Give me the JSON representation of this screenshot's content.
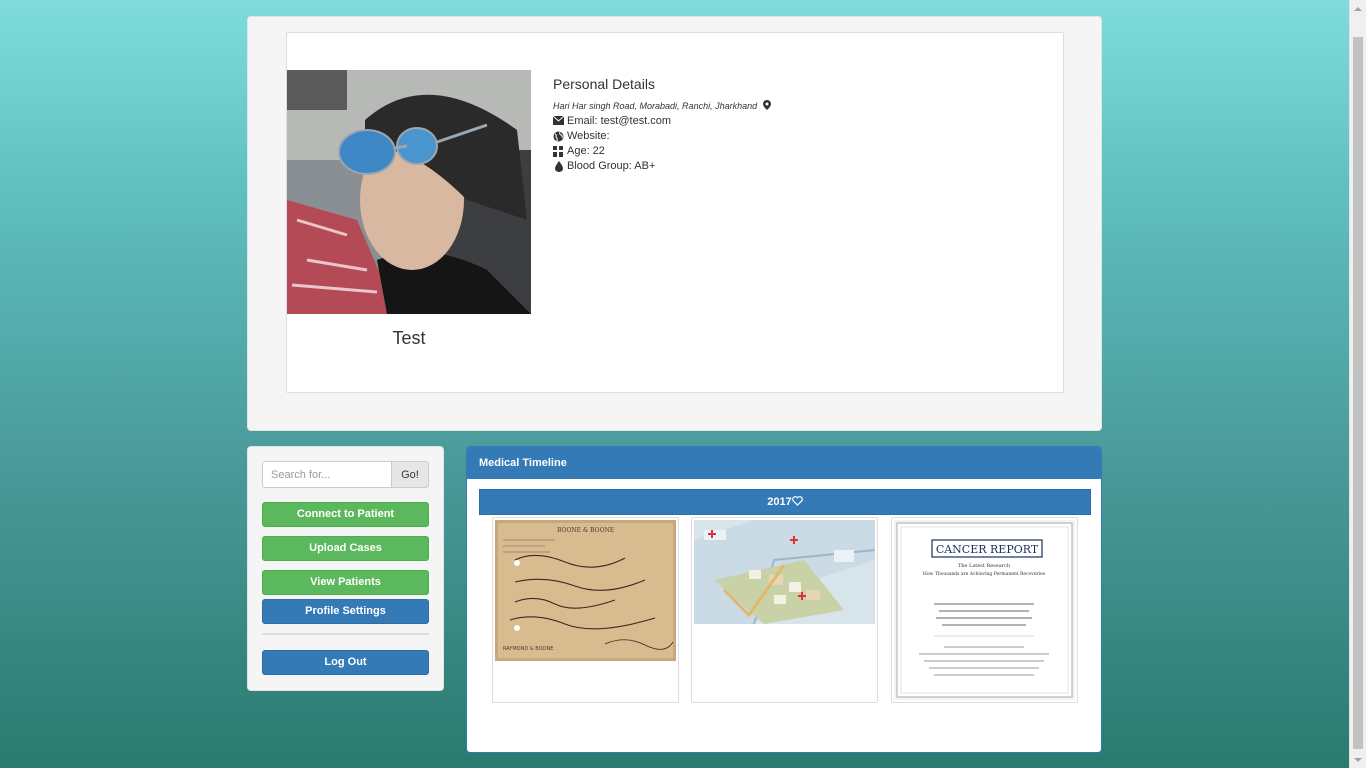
{
  "profile": {
    "name": "Test",
    "details_title": "Personal Details",
    "address": "Hari Har singh Road, Morabadi, Ranchi, Jharkhand",
    "email_label": "Email: test@test.com",
    "website_label": "Website:",
    "age_label": "Age: 22",
    "blood_group_label": "Blood Group: AB+"
  },
  "sidebar": {
    "search_placeholder": "Search for...",
    "search_button": "Go!",
    "buttons": [
      {
        "label": "Connect to Patient",
        "style": "green"
      },
      {
        "label": "Upload Cases",
        "style": "green"
      },
      {
        "label": "View Patients",
        "style": "green"
      },
      {
        "label": "Profile Settings",
        "style": "blue"
      },
      {
        "label": "Log Out",
        "style": "blue"
      }
    ]
  },
  "timeline": {
    "heading": "Medical Timeline",
    "year_label": "2017",
    "cases": [
      {
        "name": "prescription-document",
        "header_text": "BOONE & BOONE",
        "footer_text": "RAYMOND & BOONE"
      },
      {
        "name": "aerial-city-map"
      },
      {
        "name": "cancer-report",
        "title": "CANCER REPORT",
        "subtitle": "The Latest Research",
        "tagline": "How Thousands are Achieving Permanent Recoveries"
      }
    ]
  },
  "colors": {
    "primary": "#337ab7",
    "success": "#5cb85c",
    "well": "#f5f5f5"
  }
}
